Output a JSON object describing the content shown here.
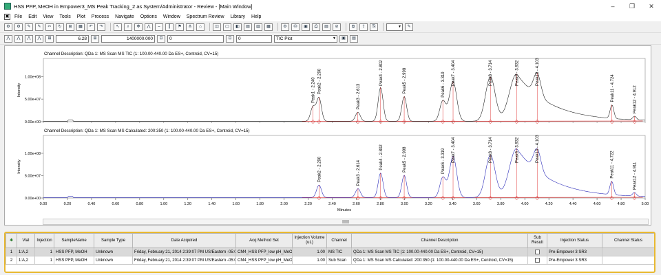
{
  "window": {
    "title": "HSS PFP, MeOH in Empower3_MS Peak Tracking_2 as System/Administrator - Review - [Main Window]",
    "controls": [
      "–",
      "❐",
      "✕"
    ]
  },
  "menu": {
    "items": [
      "File",
      "Edit",
      "View",
      "Tools",
      "Plot",
      "Process",
      "Navigate",
      "Options",
      "Window",
      "Spectrum Review",
      "Library",
      "Help"
    ]
  },
  "toolbar2": {
    "field1": "6.28",
    "field2": "1400000.000",
    "field3": "0",
    "field4": "0",
    "plot_select": "TIC Plot"
  },
  "chart_data": [
    {
      "type": "line",
      "title": "Channel Description: QDa 1: MS Scan MS TIC (1: 100.00-440.00 Da ES+, Centroid, CV=15)",
      "ylabel": "Intensity",
      "xlim": [
        0.0,
        5.0
      ],
      "ylim": [
        0,
        140000000.0
      ],
      "y_ticks": [
        "0.00e+00",
        "5.00e+07",
        "1.00e+08"
      ],
      "y_tick_values": [
        0,
        50000000.0,
        100000000.0
      ],
      "peaks": [
        {
          "label": "Peak1 - 2.240",
          "rt": 2.24,
          "height": 32000000.0,
          "width": 0.02
        },
        {
          "label": "Peak2 - 2.290",
          "rt": 2.29,
          "height": 52000000.0,
          "width": 0.02
        },
        {
          "label": "Peak3 - 2.613",
          "rt": 2.613,
          "height": 20000000.0,
          "width": 0.02
        },
        {
          "label": "Peak4 - 2.802",
          "rt": 2.802,
          "height": 75000000.0,
          "width": 0.02
        },
        {
          "label": "Peak5 - 2.998",
          "rt": 2.998,
          "height": 55000000.0,
          "width": 0.02
        },
        {
          "label": "Peak6 - 3.319",
          "rt": 3.319,
          "height": 45000000.0,
          "width": 0.025
        },
        {
          "label": "Peak7 - 3.404",
          "rt": 3.404,
          "height": 88000000.0,
          "width": 0.03
        },
        {
          "label": "Peak8 - 3.714",
          "rt": 3.714,
          "height": 98000000.0,
          "width": 0.04
        },
        {
          "label": "Peak9 - 3.932",
          "rt": 3.932,
          "height": 105000000.0,
          "width": 0.06
        },
        {
          "label": "Peak10 - 4.103",
          "rt": 4.103,
          "height": 50000000.0,
          "width": 0.03
        },
        {
          "label": "Peak11 - 4.724",
          "rt": 4.724,
          "height": 30000000.0,
          "width": 0.015
        },
        {
          "label": "Peak12 - 4.912",
          "rt": 4.912,
          "height": 8000000.0,
          "width": 0.015
        }
      ]
    },
    {
      "type": "line",
      "title": "Channel Description: QDa 1: MS Scan MS Calculated: 200:350 (1: 100.00-440.00 Da ES+, Centroid, CV=15)",
      "ylabel": "Intensity",
      "xlabel": "Minutes",
      "xlim": [
        0.0,
        5.0
      ],
      "ylim": [
        0,
        140000000.0
      ],
      "y_ticks": [
        "0.00e+00",
        "5.00e+07",
        "1.00e+08"
      ],
      "y_tick_values": [
        0,
        50000000.0,
        100000000.0
      ],
      "x_ticks": [
        "0.00",
        "0.20",
        "0.40",
        "0.60",
        "0.80",
        "1.00",
        "1.20",
        "1.40",
        "1.60",
        "1.80",
        "2.00",
        "2.20",
        "2.40",
        "2.60",
        "2.80",
        "3.00",
        "3.20",
        "3.40",
        "3.60",
        "3.80",
        "4.00",
        "4.20",
        "4.40",
        "4.60",
        "4.80",
        "5.00"
      ],
      "x_tick_values": [
        0.0,
        0.2,
        0.4,
        0.6,
        0.8,
        1.0,
        1.2,
        1.4,
        1.6,
        1.8,
        2.0,
        2.2,
        2.4,
        2.6,
        2.8,
        3.0,
        3.2,
        3.4,
        3.6,
        3.8,
        4.0,
        4.2,
        4.4,
        4.6,
        4.8,
        5.0
      ],
      "peaks": [
        {
          "label": "Peak2 - 2.290",
          "rt": 2.29,
          "height": 28000000.0,
          "width": 0.02
        },
        {
          "label": "Peak3 - 2.614",
          "rt": 2.614,
          "height": 20000000.0,
          "width": 0.02
        },
        {
          "label": "Peak4 - 2.802",
          "rt": 2.802,
          "height": 55000000.0,
          "width": 0.02
        },
        {
          "label": "Peak5 - 2.998",
          "rt": 2.998,
          "height": 50000000.0,
          "width": 0.02
        },
        {
          "label": "Peak6 - 3.319",
          "rt": 3.319,
          "height": 45000000.0,
          "width": 0.025
        },
        {
          "label": "Peak7 - 3.404",
          "rt": 3.404,
          "height": 92000000.0,
          "width": 0.03
        },
        {
          "label": "Peak8 - 3.714",
          "rt": 3.714,
          "height": 95000000.0,
          "width": 0.04
        },
        {
          "label": "Peak9 - 3.932",
          "rt": 3.932,
          "height": 110000000.0,
          "width": 0.06
        },
        {
          "label": "Peak10 - 4.103",
          "rt": 4.103,
          "height": 50000000.0,
          "width": 0.03
        },
        {
          "label": "Peak11 - 4.722",
          "rt": 4.722,
          "height": 30000000.0,
          "width": 0.015
        },
        {
          "label": "Peak12 - 4.911",
          "rt": 4.911,
          "height": 8000000.0,
          "width": 0.015
        }
      ]
    }
  ],
  "colors": {
    "trace1": "#222222",
    "trace2": "#2a2ab8",
    "baseline": "#e03030",
    "highlight": "#e8b830"
  },
  "table": {
    "columns": [
      "",
      "Vial",
      "Injection",
      "SampleName",
      "Sample Type",
      "Date Acquired",
      "Acq Method Set",
      "Injection Volume (uL)",
      "Channel",
      "Channel Description",
      "Sub Result",
      "Injection Status",
      "Channel Status"
    ],
    "rows": [
      {
        "num": "1",
        "vial": "1:A,2",
        "injection": "1",
        "sample_name": "HSS PFP, MeOH",
        "sample_type": "Unknown",
        "date": "Friday, February 21, 2014 2:39:07 PM US/Eastern -05:00",
        "method": "CM4_HSS PFP_low pH_MeOH",
        "volume": "1.00",
        "channel": "MS TIC",
        "description": "QDa 1: MS Scan MS TIC (1: 100.00-440.00 Da ES+, Centroid, CV=15)",
        "inj_status": "Pre-Empower 3 SR3",
        "ch_status": ""
      },
      {
        "num": "2",
        "vial": "1:A,2",
        "injection": "1",
        "sample_name": "HSS PFP, MeOH",
        "sample_type": "Unknown",
        "date": "Friday, February 21, 2014 2:39:07 PM US/Eastern -05:00",
        "method": "CM4_HSS PFP_low pH_MeOH",
        "volume": "1.00",
        "channel": "Sub Scan",
        "description": "QDa 1: MS Scan MS Calculated: 200:350 (1: 100.00-440.00 Da ES+, Centroid, CV=15)",
        "inj_status": "Pre-Empower 3 SR3",
        "ch_status": ""
      }
    ]
  }
}
